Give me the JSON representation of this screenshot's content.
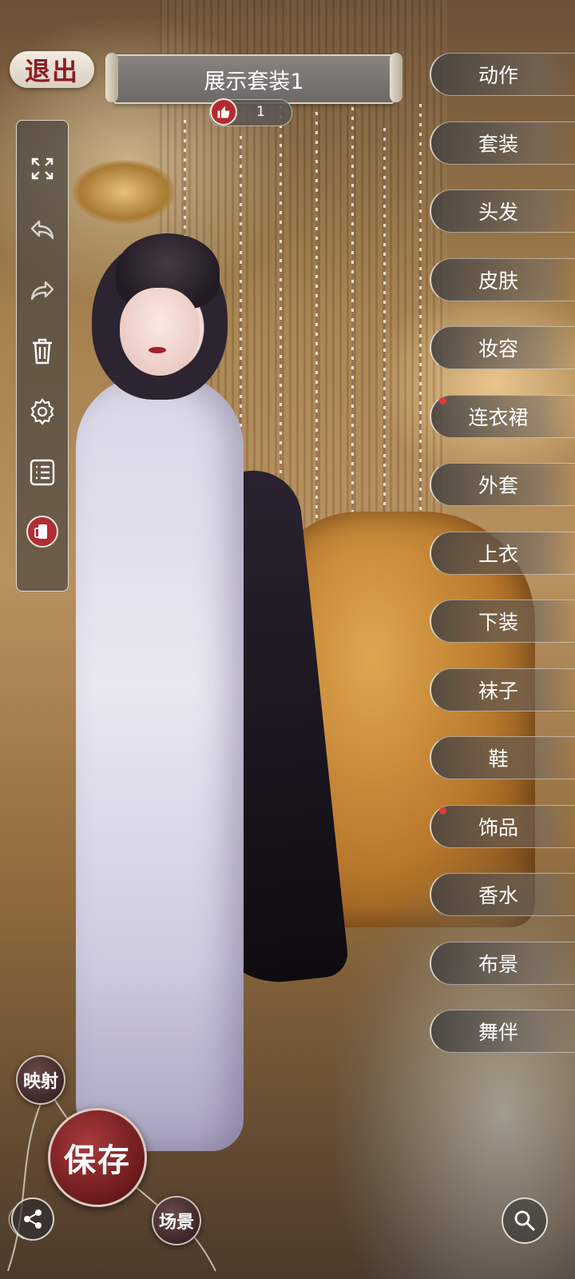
{
  "header": {
    "back_label": "退出",
    "outfit_title": "展示套装1",
    "like_count": "1"
  },
  "toolbar": {
    "items": [
      {
        "name": "fullscreen-icon"
      },
      {
        "name": "undo-icon"
      },
      {
        "name": "redo-icon"
      },
      {
        "name": "trash-icon"
      },
      {
        "name": "gear-icon"
      },
      {
        "name": "list-icon"
      },
      {
        "name": "phone-rotate-icon"
      }
    ]
  },
  "categories": [
    {
      "label": "动作",
      "badge": false
    },
    {
      "label": "套装",
      "badge": false
    },
    {
      "label": "头发",
      "badge": false
    },
    {
      "label": "皮肤",
      "badge": false
    },
    {
      "label": "妆容",
      "badge": false
    },
    {
      "label": "连衣裙",
      "badge": true
    },
    {
      "label": "外套",
      "badge": false
    },
    {
      "label": "上衣",
      "badge": false
    },
    {
      "label": "下装",
      "badge": false
    },
    {
      "label": "袜子",
      "badge": false
    },
    {
      "label": "鞋",
      "badge": false
    },
    {
      "label": "饰品",
      "badge": true
    },
    {
      "label": "香水",
      "badge": false
    },
    {
      "label": "布景",
      "badge": false
    },
    {
      "label": "舞伴",
      "badge": false
    }
  ],
  "bottom": {
    "mirror_label": "映射",
    "save_label": "保存",
    "scene_label": "场景"
  },
  "colors": {
    "accent_red": "#8d1c24",
    "badge_red": "#e23a3a",
    "panel_border": "#f0ece6"
  }
}
